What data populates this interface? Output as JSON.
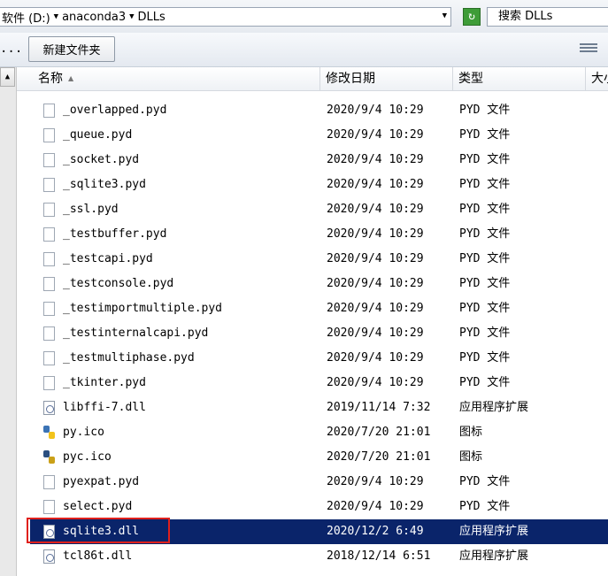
{
  "address": {
    "segments": [
      "软件 (D:)",
      "anaconda3",
      "DLLs"
    ]
  },
  "search": {
    "placeholder": "搜索 DLLs"
  },
  "toolbar": {
    "overflow": "...",
    "new_folder": "新建文件夹"
  },
  "columns": {
    "name": "名称",
    "date": "修改日期",
    "type": "类型",
    "size": "大小"
  },
  "files": [
    {
      "name": "_overlapped.pyd",
      "date": "2020/9/4 10:29",
      "type": "PYD 文件",
      "icon": "file-icon"
    },
    {
      "name": "_queue.pyd",
      "date": "2020/9/4 10:29",
      "type": "PYD 文件",
      "icon": "file-icon"
    },
    {
      "name": "_socket.pyd",
      "date": "2020/9/4 10:29",
      "type": "PYD 文件",
      "icon": "file-icon"
    },
    {
      "name": "_sqlite3.pyd",
      "date": "2020/9/4 10:29",
      "type": "PYD 文件",
      "icon": "file-icon"
    },
    {
      "name": "_ssl.pyd",
      "date": "2020/9/4 10:29",
      "type": "PYD 文件",
      "icon": "file-icon"
    },
    {
      "name": "_testbuffer.pyd",
      "date": "2020/9/4 10:29",
      "type": "PYD 文件",
      "icon": "file-icon"
    },
    {
      "name": "_testcapi.pyd",
      "date": "2020/9/4 10:29",
      "type": "PYD 文件",
      "icon": "file-icon"
    },
    {
      "name": "_testconsole.pyd",
      "date": "2020/9/4 10:29",
      "type": "PYD 文件",
      "icon": "file-icon"
    },
    {
      "name": "_testimportmultiple.pyd",
      "date": "2020/9/4 10:29",
      "type": "PYD 文件",
      "icon": "file-icon"
    },
    {
      "name": "_testinternalcapi.pyd",
      "date": "2020/9/4 10:29",
      "type": "PYD 文件",
      "icon": "file-icon"
    },
    {
      "name": "_testmultiphase.pyd",
      "date": "2020/9/4 10:29",
      "type": "PYD 文件",
      "icon": "file-icon"
    },
    {
      "name": "_tkinter.pyd",
      "date": "2020/9/4 10:29",
      "type": "PYD 文件",
      "icon": "file-icon"
    },
    {
      "name": "libffi-7.dll",
      "date": "2019/11/14 7:32",
      "type": "应用程序扩展",
      "icon": "dll-icon"
    },
    {
      "name": "py.ico",
      "date": "2020/7/20 21:01",
      "type": "图标",
      "icon": "python-icon"
    },
    {
      "name": "pyc.ico",
      "date": "2020/7/20 21:01",
      "type": "图标",
      "icon": "python-compiled-icon"
    },
    {
      "name": "pyexpat.pyd",
      "date": "2020/9/4 10:29",
      "type": "PYD 文件",
      "icon": "file-icon"
    },
    {
      "name": "select.pyd",
      "date": "2020/9/4 10:29",
      "type": "PYD 文件",
      "icon": "file-icon"
    },
    {
      "name": "sqlite3.dll",
      "date": "2020/12/2 6:49",
      "type": "应用程序扩展",
      "icon": "dll-icon",
      "selected": true
    },
    {
      "name": "tcl86t.dll",
      "date": "2018/12/14 6:51",
      "type": "应用程序扩展",
      "icon": "dll-icon"
    }
  ],
  "colors": {
    "selection": "#0a246a",
    "highlight_box": "#e0201c",
    "refresh": "#3e9c38"
  }
}
